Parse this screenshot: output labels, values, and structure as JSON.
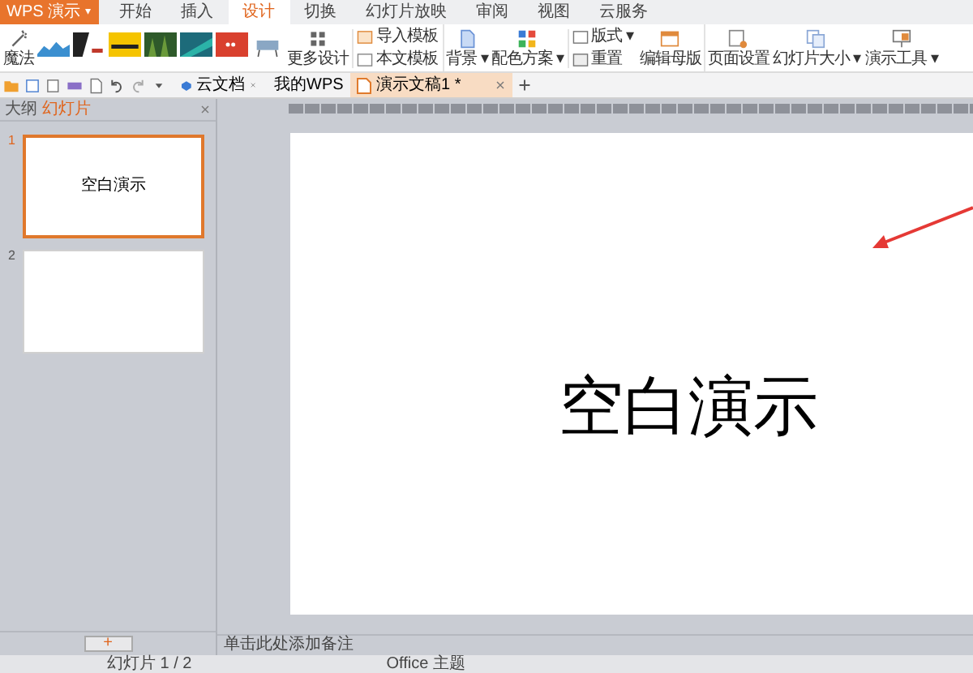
{
  "app": {
    "title": "WPS 演示",
    "menu_caret": "▾"
  },
  "menu_tabs": [
    {
      "label": "开始",
      "selected": false
    },
    {
      "label": "插入",
      "selected": false
    },
    {
      "label": "设计",
      "selected": true
    },
    {
      "label": "切换",
      "selected": false
    },
    {
      "label": "幻灯片放映",
      "selected": false
    },
    {
      "label": "审阅",
      "selected": false
    },
    {
      "label": "视图",
      "selected": false
    },
    {
      "label": "云服务",
      "selected": false
    }
  ],
  "ribbon": {
    "magic": "魔法",
    "more_designs": "更多设计",
    "import_template": "导入模板",
    "this_template": "本文模板",
    "background": "背景 ▾",
    "color_scheme": "配色方案 ▾",
    "layout": "版式 ▾",
    "reset": "重置",
    "edit_master": "编辑母版",
    "page_setup": "页面设置",
    "slide_size": "幻灯片大小 ▾",
    "presentation_tools": "演示工具 ▾"
  },
  "doc_tabs": [
    {
      "label": "云文档",
      "selected": false
    },
    {
      "label": "我的WPS",
      "selected": false
    },
    {
      "label": "演示文稿1 *",
      "selected": true
    }
  ],
  "panel_tabs": [
    {
      "label": "大纲",
      "selected": false
    },
    {
      "label": "幻灯片",
      "selected": true
    }
  ],
  "slides": [
    {
      "number": "1",
      "title": "空白演示",
      "selected": true
    },
    {
      "number": "2",
      "selected": false
    }
  ],
  "add_slide": "+",
  "canvas": {
    "title": "空白演示"
  },
  "notes_placeholder": "单击此处添加备注",
  "status_bar": {
    "slide": "幻灯片 1 / 2",
    "theme": "Office 主题"
  }
}
